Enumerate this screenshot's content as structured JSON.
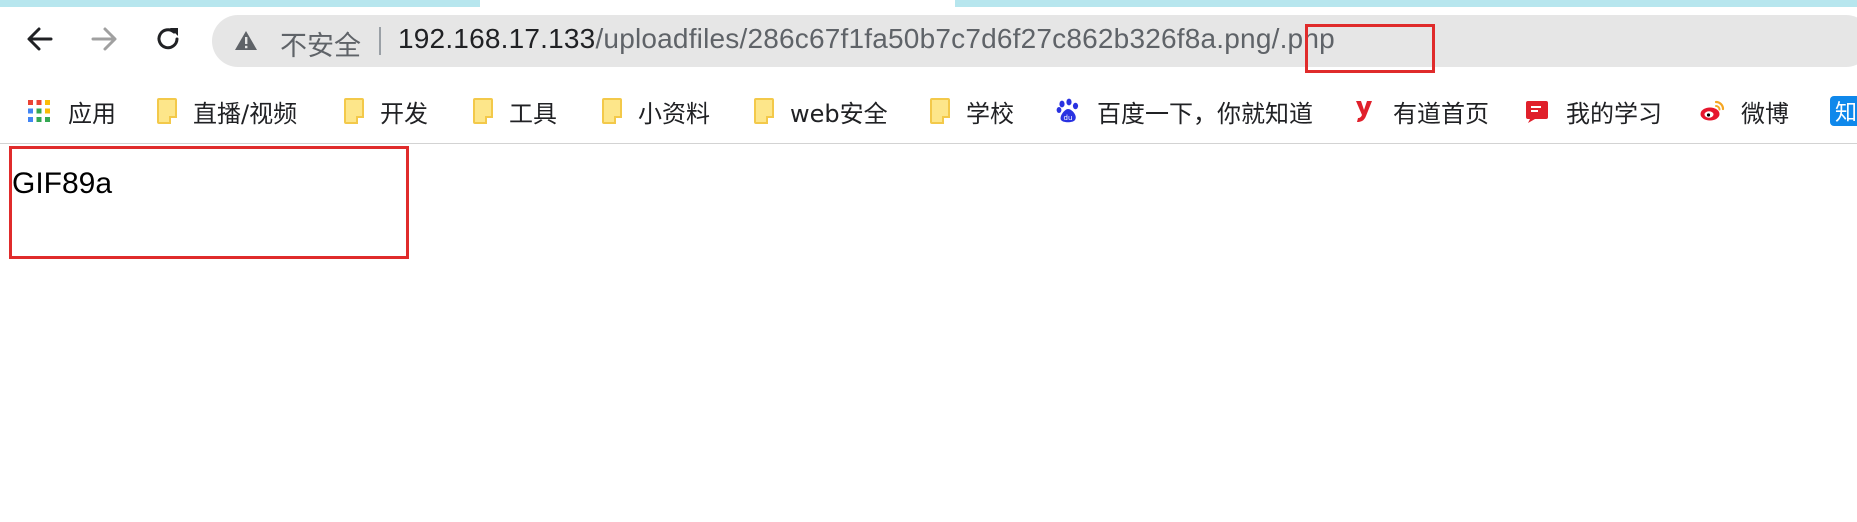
{
  "browser": {
    "security_label": "不安全",
    "url_host": "192.168.17.133",
    "url_path": "/uploadfiles/286c67f1fa50b7c7d6f27c862b326f8a.png/.php",
    "icons": {
      "back": "back-arrow-icon",
      "forward": "forward-arrow-icon",
      "reload": "reload-icon",
      "security": "warning-icon"
    }
  },
  "bookmarks": [
    {
      "label": "应用",
      "icon": "apps-grid-icon"
    },
    {
      "label": "直播/视频",
      "icon": "folder-icon"
    },
    {
      "label": "开发",
      "icon": "folder-icon"
    },
    {
      "label": "工具",
      "icon": "folder-icon"
    },
    {
      "label": "小资料",
      "icon": "folder-icon"
    },
    {
      "label": "web安全",
      "icon": "folder-icon"
    },
    {
      "label": "学校",
      "icon": "folder-icon"
    },
    {
      "label": "百度一下，你就知道",
      "icon": "baidu-paw-icon"
    },
    {
      "label": "有道首页",
      "icon": "youdao-icon"
    },
    {
      "label": "我的学习",
      "icon": "study-book-icon"
    },
    {
      "label": "微博",
      "icon": "weibo-icon"
    },
    {
      "label": "知",
      "icon": "zhihu-icon"
    }
  ],
  "page": {
    "body_text": "GIF89a"
  },
  "colors": {
    "highlight": "#e02b2b",
    "omnibox_bg": "#e6e6e6",
    "tab_accent": "#b7e6ee"
  }
}
